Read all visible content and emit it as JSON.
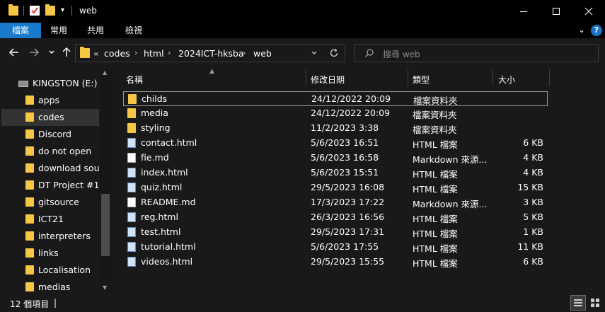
{
  "window": {
    "title": "web",
    "minimize": "—",
    "maximize": "☐",
    "close": "✕"
  },
  "ribbon": {
    "tabs": [
      "檔案",
      "常用",
      "共用",
      "檢視"
    ],
    "help": "?",
    "expand": "⌄"
  },
  "address": {
    "overflow": "«",
    "crumbs": [
      "codes",
      "html",
      "2024ICT-hksba",
      "web"
    ],
    "search_placeholder": "搜尋 web"
  },
  "nav": {
    "drive": "KINGSTON (E:)",
    "items": [
      "apps",
      "codes",
      "Discord",
      "do not open",
      "download sour",
      "DT Project #1",
      "gitsource",
      "ICT21",
      "interpreters",
      "links",
      "Localisation",
      "medias"
    ],
    "selected_index": 1
  },
  "columns": {
    "name": "名稱",
    "date": "修改日期",
    "type": "類型",
    "size": "大小"
  },
  "files": [
    {
      "name": "childs",
      "date": "24/12/2022 20:09",
      "type": "檔案資料夾",
      "size": "",
      "icon": "folder-icon"
    },
    {
      "name": "media",
      "date": "24/12/2022 20:09",
      "type": "檔案資料夾",
      "size": "",
      "icon": "folder-icon"
    },
    {
      "name": "styling",
      "date": "11/2/2023 3:38",
      "type": "檔案資料夾",
      "size": "",
      "icon": "folder-icon"
    },
    {
      "name": "contact.html",
      "date": "5/6/2023 16:51",
      "type": "HTML 檔案",
      "size": "6 KB",
      "icon": "html-file-icon"
    },
    {
      "name": "fie.md",
      "date": "5/6/2023 16:58",
      "type": "Markdown 來源...",
      "size": "4 KB",
      "icon": "md-file-icon"
    },
    {
      "name": "index.html",
      "date": "5/6/2023 15:51",
      "type": "HTML 檔案",
      "size": "4 KB",
      "icon": "html-file-icon"
    },
    {
      "name": "quiz.html",
      "date": "29/5/2023 16:08",
      "type": "HTML 檔案",
      "size": "15 KB",
      "icon": "html-file-icon"
    },
    {
      "name": "README.md",
      "date": "17/3/2023 17:22",
      "type": "Markdown 來源...",
      "size": "3 KB",
      "icon": "md-file-icon"
    },
    {
      "name": "reg.html",
      "date": "26/3/2023 16:56",
      "type": "HTML 檔案",
      "size": "5 KB",
      "icon": "html-file-icon"
    },
    {
      "name": "test.html",
      "date": "29/5/2023 17:31",
      "type": "HTML 檔案",
      "size": "1 KB",
      "icon": "html-file-icon"
    },
    {
      "name": "tutorial.html",
      "date": "5/6/2023 17:55",
      "type": "HTML 檔案",
      "size": "11 KB",
      "icon": "html-file-icon"
    },
    {
      "name": "videos.html",
      "date": "29/5/2023 15:55",
      "type": "HTML 檔案",
      "size": "6 KB",
      "icon": "html-file-icon"
    }
  ],
  "status": {
    "count": "12 個項目",
    "cursor": "|"
  },
  "colors": {
    "background": "#191919",
    "titlebar": "#000000",
    "active_tab": "#1979ca",
    "folder": "#f6c744",
    "selected_nav": "#333333"
  }
}
